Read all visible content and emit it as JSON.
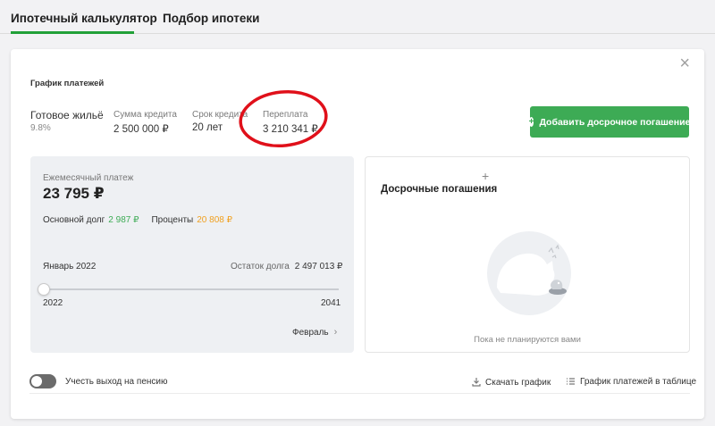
{
  "tabs": [
    {
      "label": "Ипотечный калькулятор",
      "active": true
    },
    {
      "label": "Подбор ипотеки",
      "active": false
    }
  ],
  "colors": {
    "accent": "#21a038",
    "button": "#3dab55",
    "green_value": "#3dab55",
    "orange_value": "#f0a020",
    "annotation": "#e0101a"
  },
  "card": {
    "section_title": "График платежей",
    "product": {
      "name": "Готовое жильё",
      "rate": "9.8%"
    },
    "stats": [
      {
        "label": "Сумма кредита",
        "value": "2 500 000 ₽"
      },
      {
        "label": "Срок кредита",
        "value": "20 лет"
      },
      {
        "label": "Переплата",
        "value": "3 210 341 ₽"
      }
    ],
    "add_button_label": "Добавить досрочное погашение",
    "payment": {
      "label": "Ежемесячный платеж",
      "value": "23 795 ₽",
      "principal_label": "Основной долг",
      "principal_value": "2 987 ₽",
      "interest_label": "Проценты",
      "interest_value": "20 808 ₽",
      "month": "Январь 2022",
      "balance_label": "Остаток долга",
      "balance_value": "2 497 013 ₽",
      "year_start": "2022",
      "year_end": "2041",
      "next_month": "Февраль"
    },
    "early": {
      "title": "Досрочные погашения",
      "empty_text": "Пока не планируются вами"
    },
    "footer": {
      "pension_label": "Учесть выход на пенсию",
      "download_label": "Скачать график",
      "table_label": "График платежей в таблице"
    }
  }
}
